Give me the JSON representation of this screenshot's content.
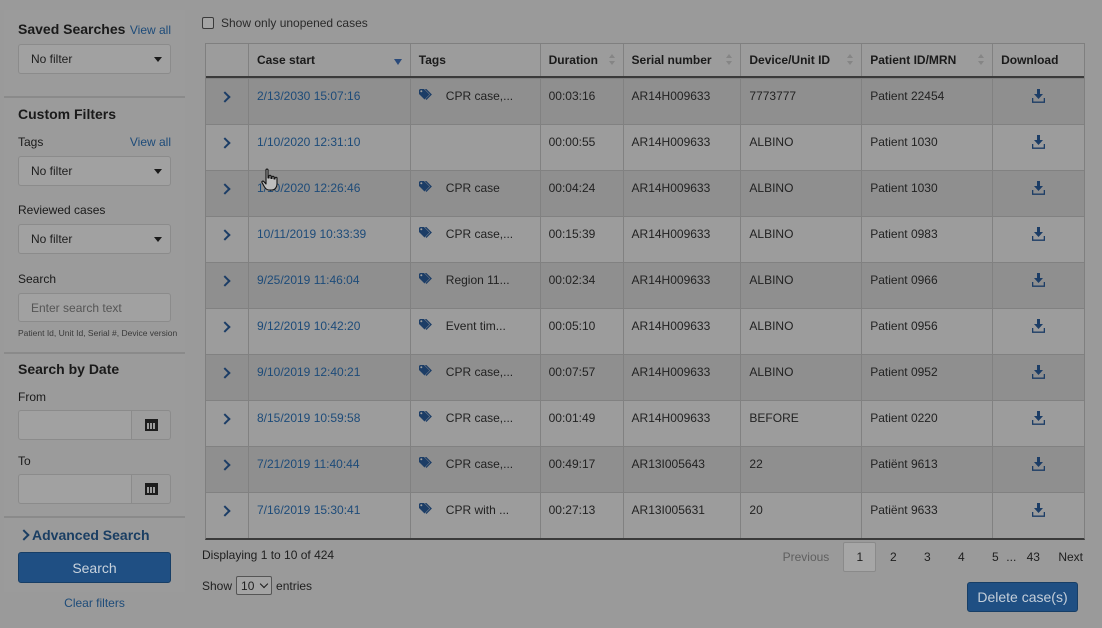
{
  "sidebar": {
    "saved_searches": {
      "title": "Saved Searches",
      "view_all": "View all",
      "select_value": "No filter"
    },
    "custom_filters": {
      "title": "Custom Filters",
      "tags_label": "Tags",
      "tags_view_all": "View all",
      "tags_value": "No filter",
      "reviewed_label": "Reviewed cases",
      "reviewed_value": "No filter",
      "search_label": "Search",
      "search_placeholder": "Enter search text",
      "search_hint": "Patient Id, Unit Id, Serial #, Device version"
    },
    "search_by_date": {
      "title": "Search by Date",
      "from_label": "From",
      "to_label": "To"
    },
    "advanced_search": "Advanced Search",
    "search_button": "Search",
    "clear_filters": "Clear filters"
  },
  "top": {
    "only_unopened_label": "Show only unopened cases"
  },
  "table": {
    "headers": [
      "Case start",
      "Tags",
      "Duration",
      "Serial number",
      "Device/Unit ID",
      "Patient ID/MRN",
      "Download"
    ],
    "rows": [
      {
        "case_start": "2/13/2030 15:07:16",
        "tags": "CPR case,...",
        "duration": "00:03:16",
        "serial": "AR14H009633",
        "device": "7773777",
        "patient": "Patient 22454"
      },
      {
        "case_start": "1/10/2020 12:31:10",
        "tags": "",
        "duration": "00:00:55",
        "serial": "AR14H009633",
        "device": "ALBINO",
        "patient": "Patient 1030"
      },
      {
        "case_start": "1/10/2020 12:26:46",
        "tags": "CPR case",
        "duration": "00:04:24",
        "serial": "AR14H009633",
        "device": "ALBINO",
        "patient": "Patient 1030"
      },
      {
        "case_start": "10/11/2019 10:33:39",
        "tags": "CPR case,...",
        "duration": "00:15:39",
        "serial": "AR14H009633",
        "device": "ALBINO",
        "patient": "Patient 0983"
      },
      {
        "case_start": "9/25/2019 11:46:04",
        "tags": "Region 11...",
        "duration": "00:02:34",
        "serial": "AR14H009633",
        "device": "ALBINO",
        "patient": "Patient 0966"
      },
      {
        "case_start": "9/12/2019 10:42:20",
        "tags": "Event tim...",
        "duration": "00:05:10",
        "serial": "AR14H009633",
        "device": "ALBINO",
        "patient": "Patient 0956"
      },
      {
        "case_start": "9/10/2019 12:40:21",
        "tags": "CPR case,...",
        "duration": "00:07:57",
        "serial": "AR14H009633",
        "device": "ALBINO",
        "patient": "Patient 0952"
      },
      {
        "case_start": "8/15/2019 10:59:58",
        "tags": "CPR case,...",
        "duration": "00:01:49",
        "serial": "AR14H009633",
        "device": "BEFORE",
        "patient": "Patient 0220"
      },
      {
        "case_start": "7/21/2019 11:40:44",
        "tags": "CPR case,...",
        "duration": "00:49:17",
        "serial": "AR13I005643",
        "device": "22",
        "patient": "Patiënt 9613"
      },
      {
        "case_start": "7/16/2019 15:30:41",
        "tags": "CPR with ...",
        "duration": "00:27:13",
        "serial": "AR13I005631",
        "device": "20",
        "patient": "Patiënt 9633"
      }
    ]
  },
  "footer": {
    "displaying": "Displaying 1 to 10 of 424",
    "show_label": "Show",
    "show_value": "10",
    "entries_label": "entries",
    "pager": {
      "previous": "Previous",
      "pages": [
        "1",
        "2",
        "3",
        "4",
        "5"
      ],
      "ellipsis": "...",
      "last": "43",
      "next": "Next",
      "current": "1"
    },
    "delete_button": "Delete case(s)"
  },
  "icons": {
    "row_expand": "chevron-right-icon",
    "tag": "tag-icon",
    "download": "download-icon",
    "calendar": "calendar-icon"
  },
  "colors": {
    "accent": "#1f4f83",
    "link": "#1d4b79"
  }
}
